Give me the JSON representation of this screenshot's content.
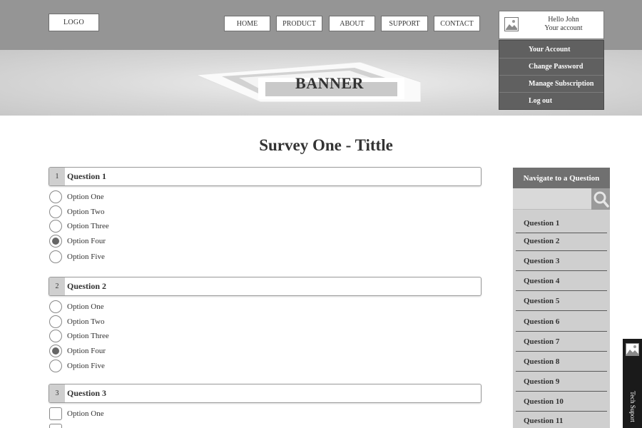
{
  "header": {
    "logo": "LOGO",
    "nav": [
      "HOME",
      "PRODUCT",
      "ABOUT",
      "SUPPORT",
      "CONTACT"
    ],
    "account": {
      "greeting": "Hello John",
      "label": "Your account"
    }
  },
  "account_menu": [
    "Your Account",
    "Change Password",
    "Manage Subscription",
    "Log out"
  ],
  "banner": {
    "text": "BANNER"
  },
  "page": {
    "title": "Survey One - Tittle"
  },
  "questions": [
    {
      "number": "1",
      "title": "Question 1",
      "type": "radio",
      "options": [
        "Option One",
        "Option Two",
        "Option Three",
        "Option Four",
        "Option Five"
      ],
      "selected": "Option Four"
    },
    {
      "number": "2",
      "title": "Question 2",
      "type": "radio",
      "options": [
        "Option One",
        "Option Two",
        "Option Three",
        "Option Four",
        "Option Five"
      ],
      "selected": "Option Four"
    },
    {
      "number": "3",
      "title": "Question 3",
      "type": "checkbox",
      "options": [
        "Option One"
      ]
    }
  ],
  "sidebar": {
    "heading": "Navigate to a Question",
    "items": [
      "Question 1",
      "Question 2",
      "Question 3",
      "Question 4",
      "Question 5",
      "Question 6",
      "Question 7",
      "Question 8",
      "Question 9",
      "Question 10",
      "Question 11"
    ]
  },
  "tech_support": {
    "label": "Tech Suport"
  },
  "icons": {
    "search": "search-icon",
    "avatar": "image-placeholder-icon"
  }
}
